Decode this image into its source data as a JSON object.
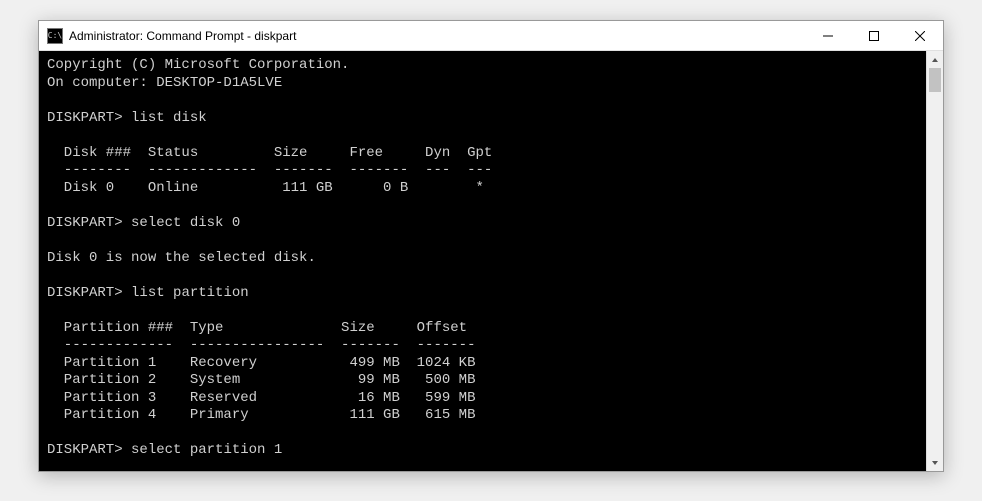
{
  "window": {
    "title": "Administrator: Command Prompt - diskpart",
    "icon_label": "C:\\"
  },
  "terminal": {
    "copyright": "Copyright (C) Microsoft Corporation.",
    "computer_line": "On computer: DESKTOP-D1A5LVE",
    "prompt": "DISKPART>",
    "cmd_list_disk": "list disk",
    "disk_header": "  Disk ###  Status         Size     Free     Dyn  Gpt",
    "disk_separator": "  --------  -------------  -------  -------  ---  ---",
    "disk_row_0": "  Disk 0    Online          111 GB      0 B        *",
    "cmd_select_disk": "select disk 0",
    "selected_msg": "Disk 0 is now the selected disk.",
    "cmd_list_partition": "list partition",
    "part_header": "  Partition ###  Type              Size     Offset",
    "part_separator": "  -------------  ----------------  -------  -------",
    "part_row_0": "  Partition 1    Recovery           499 MB  1024 KB",
    "part_row_1": "  Partition 2    System              99 MB   500 MB",
    "part_row_2": "  Partition 3    Reserved            16 MB   599 MB",
    "part_row_3": "  Partition 4    Primary            111 GB   615 MB",
    "cmd_select_partition": "select partition 1"
  }
}
